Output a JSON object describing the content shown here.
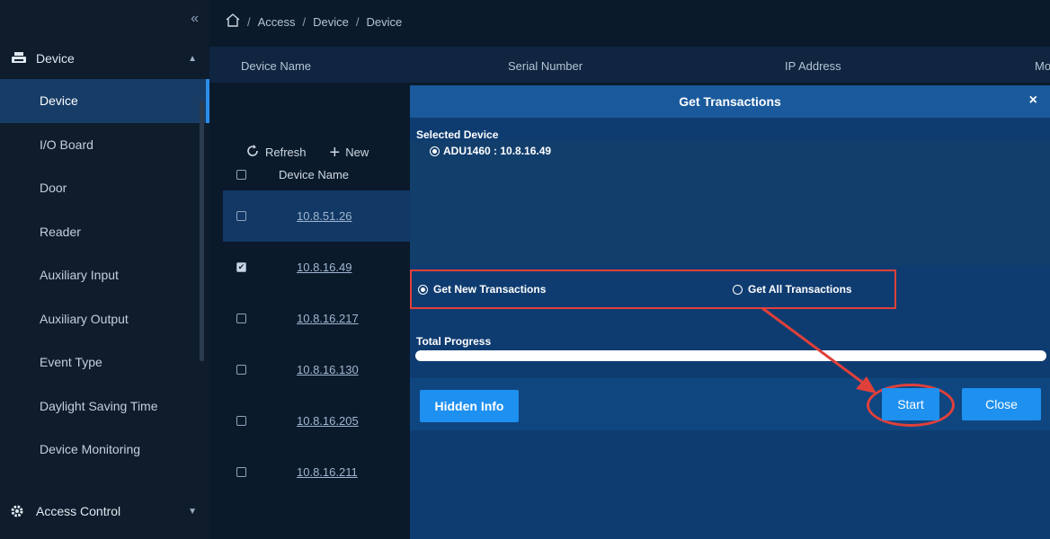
{
  "sidebar": {
    "collapse_icon": "double-chevron-left-icon",
    "group": {
      "label": "Device",
      "icon": "printer-icon",
      "caret": "▲"
    },
    "items": [
      {
        "label": "Device"
      },
      {
        "label": "I/O Board"
      },
      {
        "label": "Door"
      },
      {
        "label": "Reader"
      },
      {
        "label": "Auxiliary Input"
      },
      {
        "label": "Auxiliary Output"
      },
      {
        "label": "Event Type"
      },
      {
        "label": "Daylight Saving Time"
      },
      {
        "label": "Device Monitoring"
      }
    ],
    "bottom_group": {
      "label": "Access Control",
      "icon": "gear-icon",
      "caret": "▼"
    }
  },
  "breadcrumb": {
    "home_icon": "home-icon",
    "sep": "/",
    "items": [
      "Access",
      "Device",
      "Device"
    ]
  },
  "columns": {
    "device_name": "Device Name",
    "serial_number": "Serial Number",
    "ip_address": "IP Address",
    "more": "Mo"
  },
  "toolbar": {
    "refresh": "Refresh",
    "new": "New"
  },
  "table": {
    "header": "Device Name",
    "rows": [
      {
        "name": "10.8.51.26",
        "checked": false
      },
      {
        "name": "10.8.16.49",
        "checked": true
      },
      {
        "name": "10.8.16.217",
        "checked": false
      },
      {
        "name": "10.8.16.130",
        "checked": false
      },
      {
        "name": "10.8.16.205",
        "checked": false
      },
      {
        "name": "10.8.16.211",
        "checked": false
      }
    ]
  },
  "modal": {
    "title": "Get Transactions",
    "close_symbol": "×",
    "selected_device_label": "Selected Device",
    "device_entry": "ADU1460 : 10.8.16.49",
    "option_new": "Get New Transactions",
    "option_all": "Get All Transactions",
    "selected_option": "new",
    "progress_label": "Total Progress",
    "progress_fraction": 0,
    "hidden_info": "Hidden Info",
    "start": "Start",
    "close": "Close"
  },
  "colors": {
    "highlight": "#e0403a",
    "accent": "#1e90f0"
  }
}
